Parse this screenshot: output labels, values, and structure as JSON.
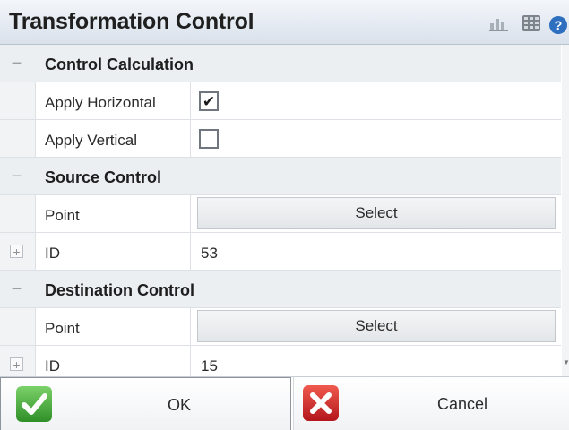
{
  "window": {
    "title": "Transformation Control",
    "toolbar_icons": [
      "bar-chart-icon",
      "keypad-grid-icon",
      "help-icon"
    ]
  },
  "sections": [
    {
      "label": "Control Calculation",
      "rows": [
        {
          "label": "Apply Horizontal",
          "type": "checkbox",
          "checked": true,
          "mark": "✔"
        },
        {
          "label": "Apply Vertical",
          "type": "checkbox",
          "checked": false,
          "mark": ""
        }
      ]
    },
    {
      "label": "Source Control",
      "rows": [
        {
          "label": "Point",
          "type": "button",
          "button_label": "Select"
        },
        {
          "label": "ID",
          "type": "text",
          "value": "53"
        }
      ]
    },
    {
      "label": "Destination Control",
      "rows": [
        {
          "label": "Point",
          "type": "button",
          "button_label": "Select"
        },
        {
          "label": "ID",
          "type": "text",
          "value": "15"
        }
      ]
    }
  ],
  "expanders": {
    "collapse": "−",
    "expand": "+"
  },
  "footer": {
    "ok_label": "OK",
    "cancel_label": "Cancel",
    "ok_icon": "green-checkmark-icon",
    "cancel_icon": "red-x-icon"
  },
  "colors": {
    "ok_green": "#4cae3d",
    "cancel_red": "#d7262a",
    "help_blue": "#2f6fbf"
  }
}
